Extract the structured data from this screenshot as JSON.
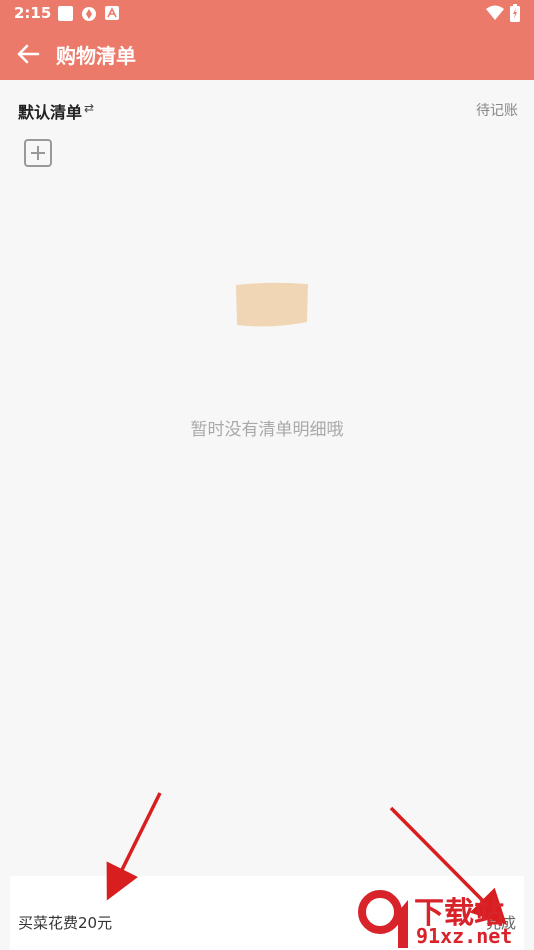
{
  "status_bar": {
    "time": "2:15"
  },
  "app_bar": {
    "title": "购物清单"
  },
  "list_header": {
    "name": "默认清单",
    "swap_symbol": "⇄",
    "pending_label": "待记账"
  },
  "empty_state": {
    "message": "暂时没有清单明细哦"
  },
  "bottom_bar": {
    "input_value": "买菜花费20元",
    "done_label": "完成"
  },
  "watermark": {
    "text_top": "下载站",
    "text_bottom": "91xz.net"
  },
  "colors": {
    "accent": "#ec7a6a",
    "background": "#f7f7f7",
    "arrow": "#d81e1e"
  }
}
